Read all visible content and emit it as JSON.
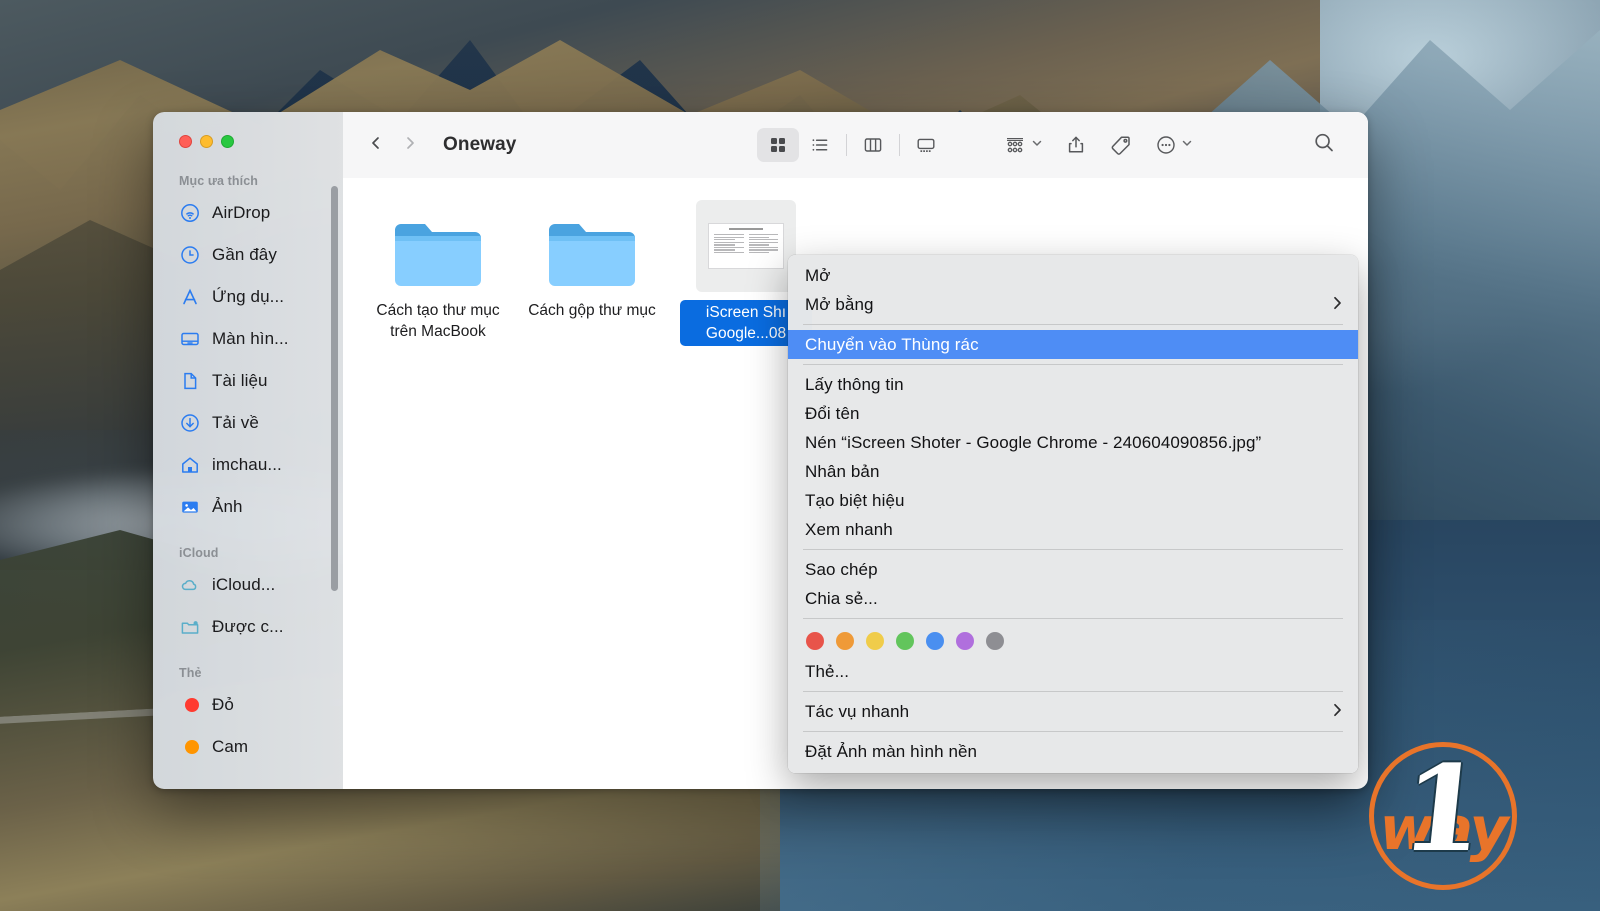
{
  "desktop": {
    "wallpaper_name": "Big Sur"
  },
  "window": {
    "title": "Oneway",
    "traffic_lights": [
      {
        "name": "close",
        "color": "#ff5f57"
      },
      {
        "name": "minimize",
        "color": "#febc2e"
      },
      {
        "name": "zoom",
        "color": "#28c840"
      }
    ],
    "nav": {
      "back": "‹",
      "forward": "›"
    }
  },
  "toolbar": {
    "views": [
      {
        "name": "icon-view",
        "label": "Icon view",
        "active": true
      },
      {
        "name": "list-view",
        "label": "List view",
        "active": false
      },
      {
        "name": "column-view",
        "label": "Column view",
        "active": false
      },
      {
        "name": "gallery-view",
        "label": "Gallery view",
        "active": false
      }
    ],
    "actions": [
      {
        "name": "group-by",
        "label": "Group items"
      },
      {
        "name": "share",
        "label": "Share"
      },
      {
        "name": "tags",
        "label": "Tags"
      },
      {
        "name": "more",
        "label": "More"
      }
    ],
    "search": {
      "label": "Search"
    }
  },
  "sidebar": {
    "sections": [
      {
        "header": "Mục ưa thích",
        "items": [
          {
            "icon": "airdrop-icon",
            "label": "AirDrop"
          },
          {
            "icon": "clock-icon",
            "label": "Gần đây"
          },
          {
            "icon": "applications-icon",
            "label": "Ứng dụ..."
          },
          {
            "icon": "desktop-icon",
            "label": "Màn hìn..."
          },
          {
            "icon": "document-icon",
            "label": "Tài liệu"
          },
          {
            "icon": "download-icon",
            "label": "Tải về"
          },
          {
            "icon": "home-icon",
            "label": "imchau..."
          },
          {
            "icon": "photos-icon",
            "label": "Ảnh"
          }
        ]
      },
      {
        "header": "iCloud",
        "items": [
          {
            "icon": "cloud-icon",
            "label": "iCloud..."
          },
          {
            "icon": "shared-folder-icon",
            "label": "Được c..."
          }
        ]
      },
      {
        "header": "Thẻ",
        "items": [
          {
            "icon": "tag-dot-red",
            "label": "Đỏ",
            "color": "#ff3b30"
          },
          {
            "icon": "tag-dot-orange",
            "label": "Cam",
            "color": "#ff9500"
          }
        ]
      }
    ]
  },
  "files": [
    {
      "type": "folder",
      "name": "Cách tạo thư mục trên MacBook",
      "selected": false
    },
    {
      "type": "folder",
      "name": "Cách gộp thư mục",
      "selected": false
    },
    {
      "type": "image",
      "name": "iScreen Shı Google...08",
      "selected": true
    }
  ],
  "context_menu": {
    "items": [
      {
        "kind": "item",
        "label": "Mở",
        "submenu": false,
        "highlight": false
      },
      {
        "kind": "item",
        "label": "Mở bằng",
        "submenu": true,
        "highlight": false
      },
      {
        "kind": "separator"
      },
      {
        "kind": "item",
        "label": "Chuyển vào Thùng rác",
        "submenu": false,
        "highlight": true
      },
      {
        "kind": "separator"
      },
      {
        "kind": "item",
        "label": "Lấy thông tin",
        "submenu": false,
        "highlight": false
      },
      {
        "kind": "item",
        "label": "Đổi tên",
        "submenu": false,
        "highlight": false
      },
      {
        "kind": "item",
        "label": "Nén “iScreen Shoter - Google Chrome - 240604090856.jpg”",
        "submenu": false,
        "highlight": false
      },
      {
        "kind": "item",
        "label": "Nhân bản",
        "submenu": false,
        "highlight": false
      },
      {
        "kind": "item",
        "label": "Tạo biệt hiệu",
        "submenu": false,
        "highlight": false
      },
      {
        "kind": "item",
        "label": "Xem nhanh",
        "submenu": false,
        "highlight": false
      },
      {
        "kind": "separator"
      },
      {
        "kind": "item",
        "label": "Sao chép",
        "submenu": false,
        "highlight": false
      },
      {
        "kind": "item",
        "label": "Chia sẻ...",
        "submenu": false,
        "highlight": false
      },
      {
        "kind": "separator"
      },
      {
        "kind": "colors"
      },
      {
        "kind": "item",
        "label": "Thẻ...",
        "submenu": false,
        "highlight": false
      },
      {
        "kind": "separator"
      },
      {
        "kind": "item",
        "label": "Tác vụ nhanh",
        "submenu": true,
        "highlight": false
      },
      {
        "kind": "separator"
      },
      {
        "kind": "item",
        "label": "Đặt Ảnh màn hình nền",
        "submenu": false,
        "highlight": false
      }
    ],
    "tag_colors": [
      {
        "name": "red",
        "hex": "#e8544a"
      },
      {
        "name": "orange",
        "hex": "#ef9a38"
      },
      {
        "name": "yellow",
        "hex": "#f0cc4a"
      },
      {
        "name": "green",
        "hex": "#62c55c"
      },
      {
        "name": "blue",
        "hex": "#4a8ff0"
      },
      {
        "name": "purple",
        "hex": "#b06fdd"
      },
      {
        "name": "gray",
        "hex": "#8e8e93"
      }
    ],
    "highlight_color": "#4e8df5"
  },
  "watermark": {
    "text_way": "way",
    "text_one": "1",
    "color": "#e8742a"
  }
}
